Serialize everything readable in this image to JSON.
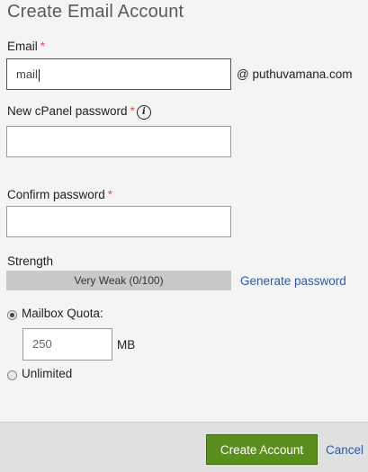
{
  "form": {
    "title": "Create Email Account",
    "email_label": "Email",
    "email_value": "mail",
    "domain": "@ puthuvamana.com",
    "new_password_label": "New cPanel password",
    "confirm_password_label": "Confirm password",
    "required_marker": "*",
    "info_icon_glyph": "i",
    "strength_label": "Strength",
    "strength_value": "Very Weak (0/100)",
    "generate_password": "Generate password",
    "mailbox_quota_label": "Mailbox Quota:",
    "quota_value": "250",
    "quota_unit": "MB",
    "unlimited_label": "Unlimited"
  },
  "footer": {
    "create_button": "Create Account",
    "cancel_link": "Cancel"
  },
  "colors": {
    "create_button": "#5a8f1e",
    "link": "#2b5aa8",
    "required": "#d9534f",
    "strength_bar": "#c9c9c9"
  }
}
